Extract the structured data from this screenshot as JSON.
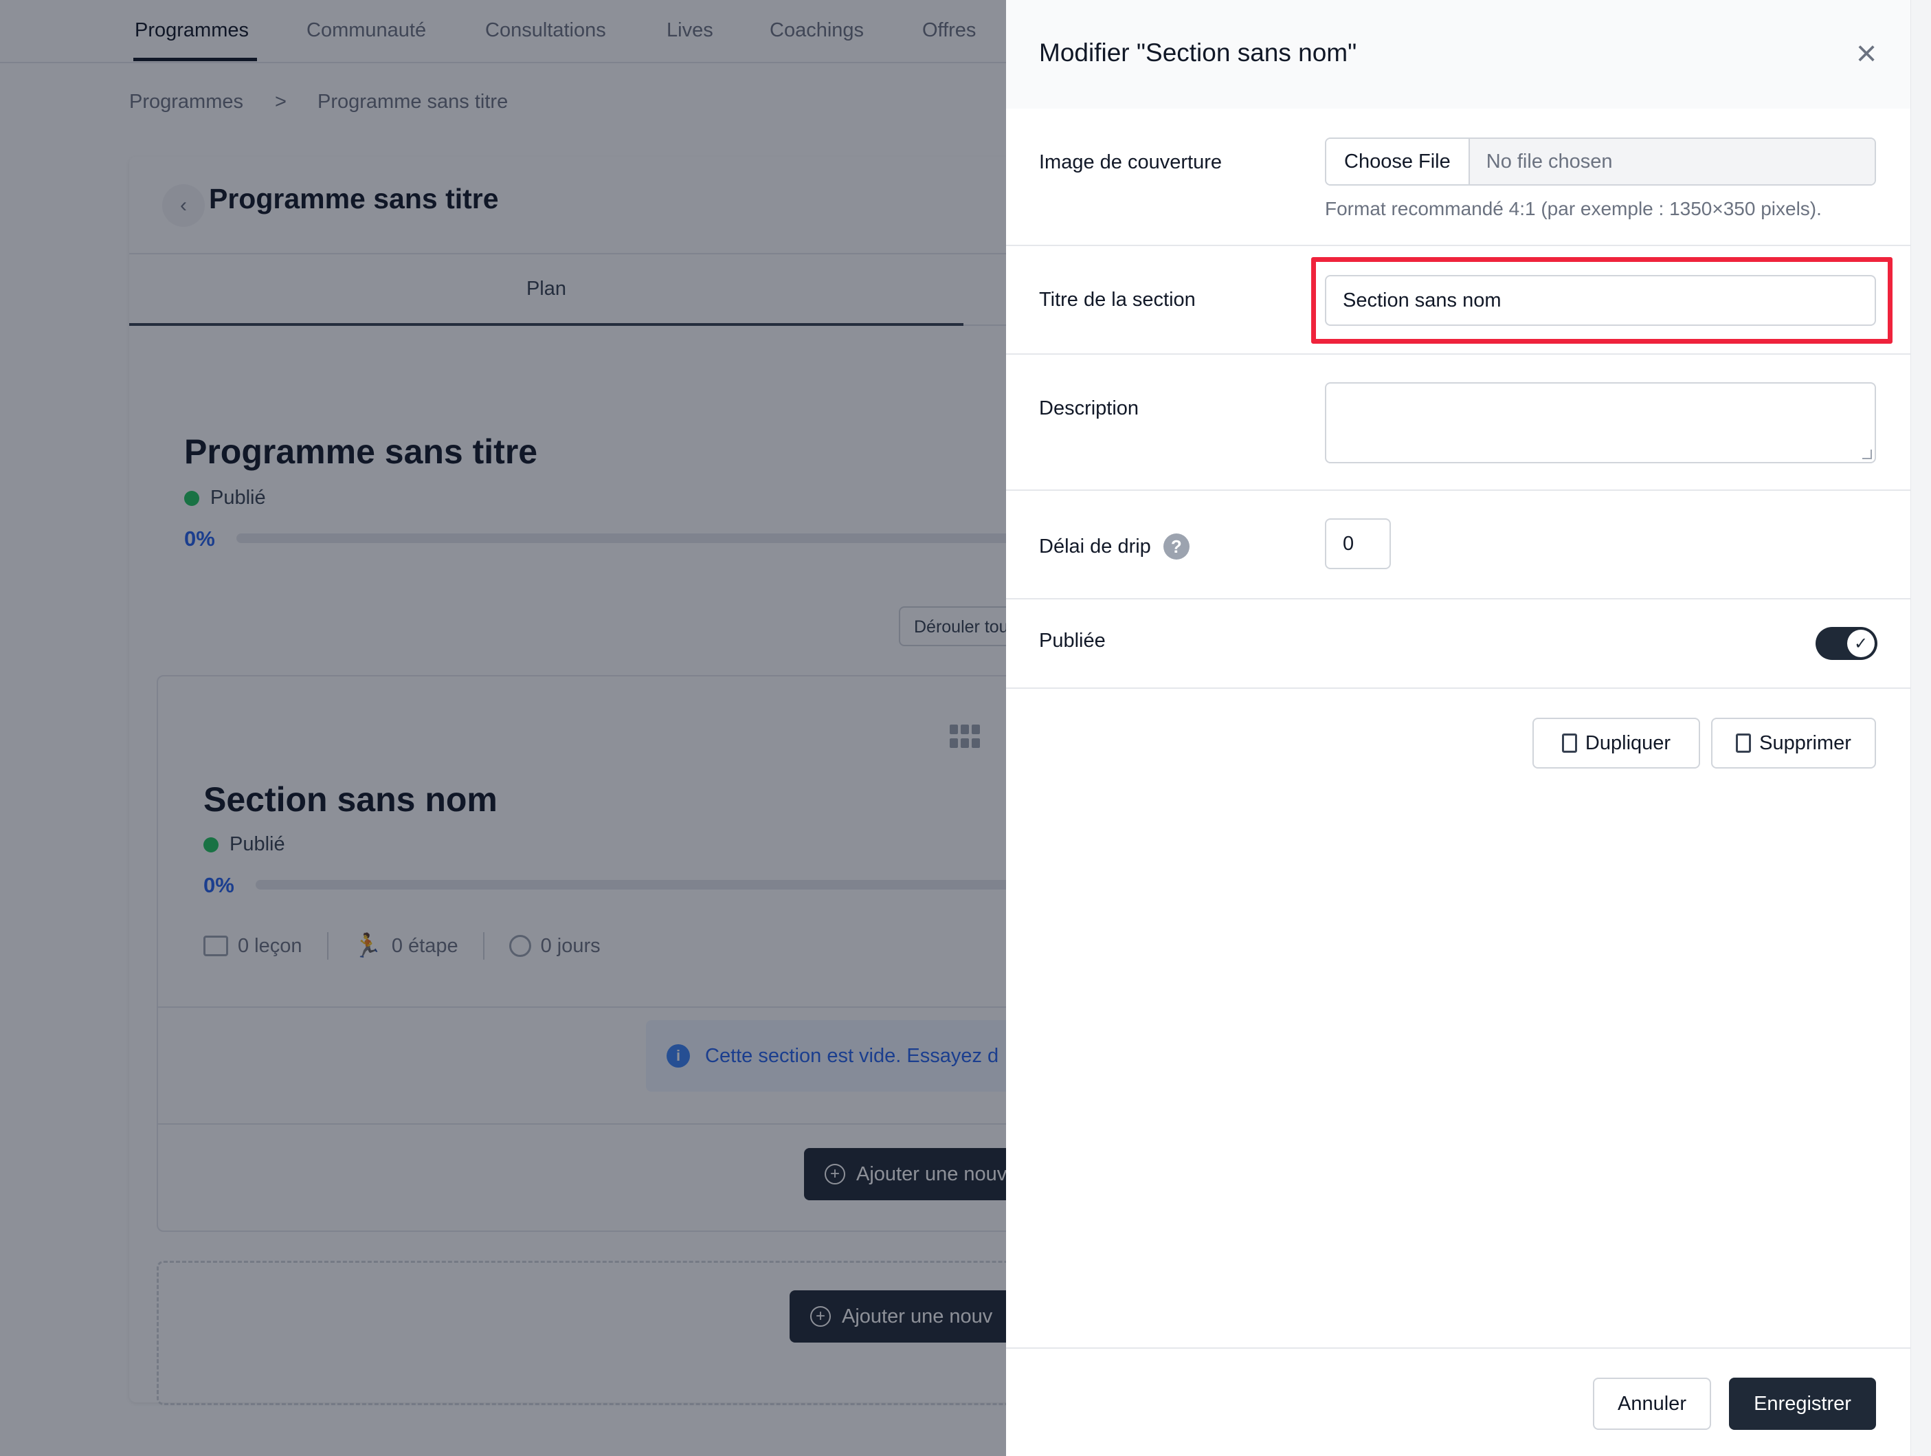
{
  "nav": {
    "tabs": [
      {
        "label": "Programmes"
      },
      {
        "label": "Communauté"
      },
      {
        "label": "Consultations"
      },
      {
        "label": "Lives"
      },
      {
        "label": "Coachings"
      },
      {
        "label": "Offres"
      }
    ]
  },
  "breadcrumb": {
    "root": "Programmes",
    "separator": ">",
    "current": "Programme sans titre"
  },
  "program": {
    "header_title": "Programme sans titre",
    "tab_plan": "Plan",
    "title": "Programme sans titre",
    "status": "Publié",
    "progress_label": "0%",
    "progress": 0,
    "unroll_button": "Dérouler tout"
  },
  "section": {
    "title": "Section sans nom",
    "status": "Publié",
    "progress_label": "0%",
    "progress": 0,
    "lessons": "0 leçon",
    "steps": "0 étape",
    "days": "0 jours",
    "empty_info": "Cette section est vide. Essayez d",
    "add_button": "Ajouter une nouv",
    "add_section_button": "Ajouter une nouv"
  },
  "panel": {
    "title": "Modifier \"Section sans nom\"",
    "close_icon": "close-icon",
    "cover_label": "Image de couverture",
    "file_button": "Choose File",
    "file_status": "No file chosen",
    "cover_hint": "Format recommandé 4:1 (par exemple : 1350×350 pixels).",
    "title_label": "Titre de la section",
    "title_value": "Section sans nom",
    "description_label": "Description",
    "description_value": "",
    "drip_label": "Délai de drip",
    "drip_help": "?",
    "drip_value": "0",
    "published_label": "Publiée",
    "published": true,
    "duplicate_button": "Dupliquer",
    "delete_button": "Supprimer",
    "cancel_button": "Annuler",
    "save_button": "Enregistrer"
  },
  "colors": {
    "highlight": "#ef233c",
    "primary_dark": "#1f2937",
    "published_dot": "#22c55e",
    "progress_text": "#2563eb"
  }
}
